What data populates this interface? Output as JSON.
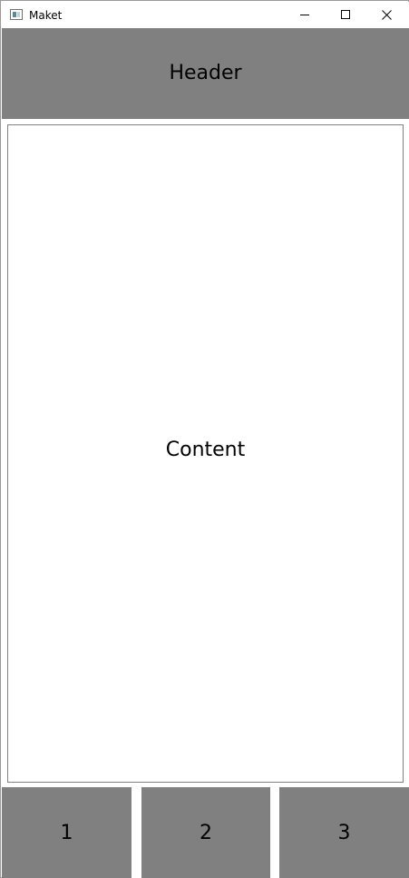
{
  "window": {
    "title": "Maket",
    "icon": "app-window-icon",
    "controls": [
      "minimize-icon",
      "maximize-icon",
      "close-icon"
    ]
  },
  "header": {
    "text": "Header",
    "background": "#808080"
  },
  "content": {
    "text": "Content",
    "border_color": "#808080"
  },
  "footer": {
    "buttons": [
      {
        "label": "1"
      },
      {
        "label": "2"
      },
      {
        "label": "3"
      }
    ],
    "background": "#808080"
  }
}
